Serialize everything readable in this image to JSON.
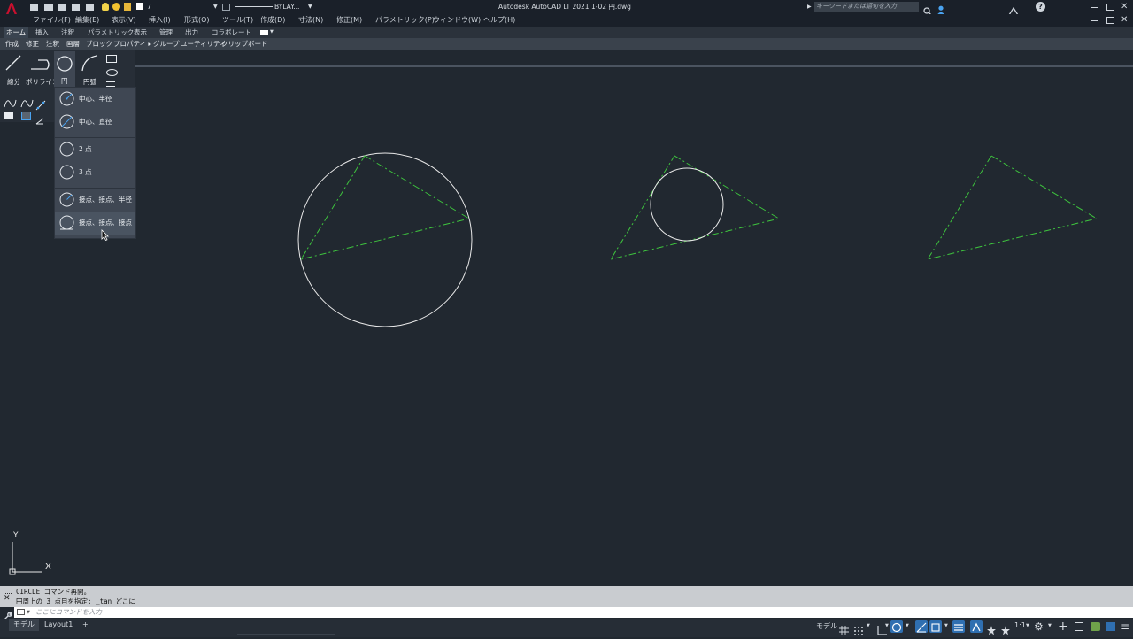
{
  "titlebar": {
    "app_title": "Autodesk AutoCAD LT 2021",
    "file_name": "1-02 円.dwg",
    "layer_name": "7",
    "linetype": "BYLAY...",
    "search_placeholder": "キーワードまたは語句を入力"
  },
  "menu": [
    "ファイル(F)",
    "編集(E)",
    "表示(V)",
    "挿入(I)",
    "形式(O)",
    "ツール(T)",
    "作成(D)",
    "寸法(N)",
    "修正(M)",
    "パラメトリック(P)",
    "ウィンドウ(W)",
    "ヘルプ(H)"
  ],
  "tabs": [
    "ホーム",
    "挿入",
    "注釈",
    "パラメトリック",
    "表示",
    "管理",
    "出力",
    "コラボレート"
  ],
  "panels": [
    "作成",
    "修正",
    "注釈",
    "画層",
    "ブロック",
    "プロパティ ▸",
    "グループ",
    "ユーティリティ",
    "クリップボード"
  ],
  "ribbon": {
    "line_label": "線分",
    "polyline_label": "ポリライン",
    "circle_label": "円",
    "arc_label": "円弧"
  },
  "circle_menu": [
    {
      "label": "中心、半径",
      "icon": "circle-center-radius-icon"
    },
    {
      "label": "中心、直径",
      "icon": "circle-center-diameter-icon"
    },
    {
      "label": "2 点",
      "icon": "circle-2point-icon"
    },
    {
      "label": "3 点",
      "icon": "circle-3point-icon"
    },
    {
      "label": "接点、接点、半径",
      "icon": "circle-ttr-icon"
    },
    {
      "label": "接点、接点、接点",
      "icon": "circle-ttt-icon"
    }
  ],
  "ucs": {
    "x_label": "X",
    "y_label": "Y"
  },
  "command": {
    "history_line1": "CIRCLE コマンド再開。",
    "history_line2": "円周上の 3 点目を指定: _tan どこに",
    "input_placeholder": "ここにコマンドを入力"
  },
  "status": {
    "model_tab": "モデル",
    "layout_tab": "Layout1",
    "model_button": "モデル",
    "scale": "1:1"
  },
  "colors": {
    "background": "#212830",
    "geometry_white": "#e8e8e8",
    "geometry_green": "#3ec43e",
    "accent_red": "#c8102e"
  }
}
